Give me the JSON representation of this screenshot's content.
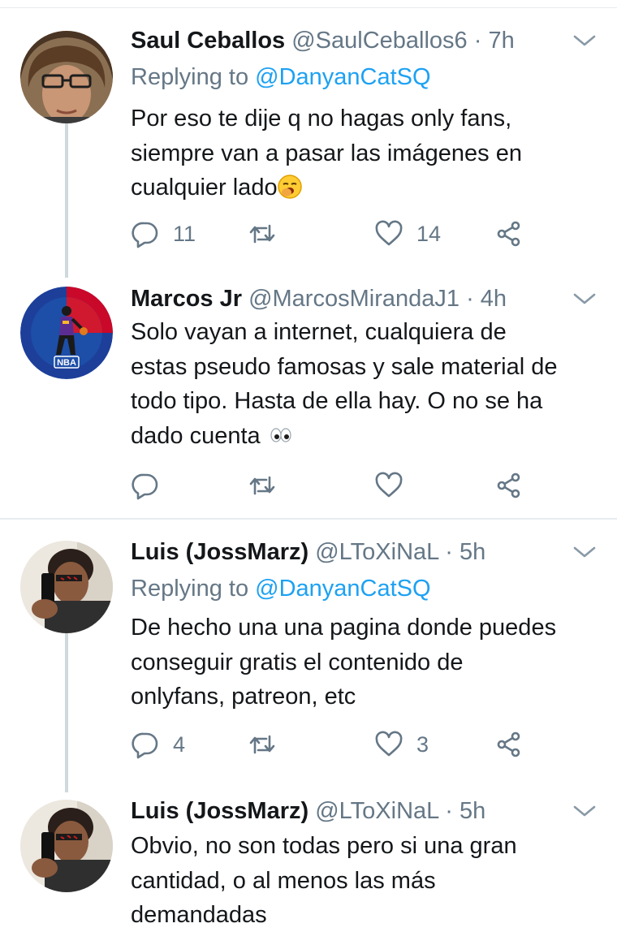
{
  "tweets": [
    {
      "name": "Saul Ceballos",
      "handle": "@SaulCeballos6",
      "time": "7h",
      "reply_prefix": "Replying to",
      "reply_to": "@DanyanCatSQ",
      "text": "Por eso te dije q no hagas only fans,\nsiempre van a pasar las imágenes en\ncualquier lado",
      "emoji": "yawning-face-icon",
      "replies": "11",
      "retweets": "",
      "likes": "14"
    },
    {
      "name": "Marcos Jr",
      "handle": "@MarcosMirandaJ1",
      "time": "4h",
      "text": "Solo vayan a internet, cualquiera de\nestas pseudo famosas y sale material de\ntodo tipo. Hasta de ella hay. O no se ha\ndado cuenta",
      "emoji": "eyes-icon",
      "replies": "",
      "retweets": "",
      "likes": "",
      "avatar_label": "NBA"
    },
    {
      "name": "Luis (JossMarz)",
      "handle": "@LToXiNaL",
      "time": "5h",
      "reply_prefix": "Replying to",
      "reply_to": "@DanyanCatSQ",
      "text": "De hecho una una pagina donde puedes\nconseguir gratis el contenido de\nonlyfans, patreon, etc",
      "replies": "4",
      "retweets": "",
      "likes": "3"
    },
    {
      "name": "Luis (JossMarz)",
      "handle": "@LToXiNaL",
      "time": "5h",
      "text": "Obvio, no son todas pero si una gran\ncantidad, o al menos las más\ndemandadas"
    }
  ],
  "separator": "·",
  "colors": {
    "text": "#14171a",
    "muted": "#657786",
    "link": "#1da1f2",
    "divider": "#e6ecf0",
    "thread_line": "#cfd9de"
  },
  "icons": [
    "reply-icon",
    "retweet-icon",
    "like-icon",
    "share-icon",
    "caret-down-icon"
  ]
}
